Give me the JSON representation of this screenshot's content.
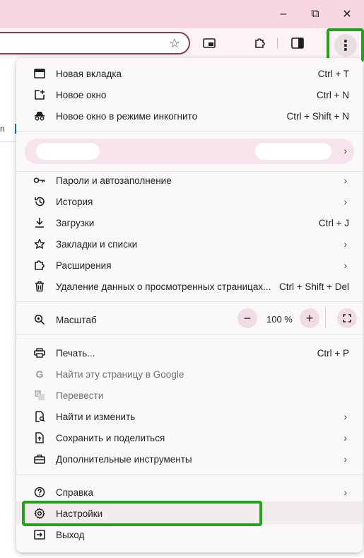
{
  "window": {
    "minimize_glyph": "–",
    "maximize_glyph": "⧉",
    "close_glyph": "✕"
  },
  "toolbar": {
    "star_glyph": "☆",
    "menu_glyph": "⋮"
  },
  "page": {
    "fragment": "n"
  },
  "menu": {
    "group1": [
      {
        "icon": "new-tab-icon",
        "label": "Новая вкладка",
        "shortcut": "Ctrl + T"
      },
      {
        "icon": "new-window-icon",
        "label": "Новое окно",
        "shortcut": "Ctrl + N"
      },
      {
        "icon": "incognito-icon",
        "label": "Новое окно в режиме инкогнито",
        "shortcut": "Ctrl + Shift + N"
      }
    ],
    "profile_chevron": "›",
    "group2": [
      {
        "icon": "key-icon",
        "label": "Пароли и автозаполнение",
        "chevron": "›"
      },
      {
        "icon": "history-icon",
        "label": "История",
        "chevron": "›"
      },
      {
        "icon": "download-icon",
        "label": "Загрузки",
        "shortcut": "Ctrl + J"
      },
      {
        "icon": "star-icon",
        "label": "Закладки и списки",
        "chevron": "›"
      },
      {
        "icon": "extension-icon",
        "label": "Расширения",
        "chevron": "›"
      },
      {
        "icon": "trash-icon",
        "label": "Удаление данных о просмотренных страницах...",
        "shortcut": "Ctrl + Shift + Del"
      }
    ],
    "zoom": {
      "label": "Масштаб",
      "minus": "−",
      "value": "100 %",
      "plus": "+"
    },
    "group3": [
      {
        "icon": "print-icon",
        "label": "Печать...",
        "shortcut": "Ctrl + P"
      },
      {
        "icon": "google-icon",
        "label": "Найти эту страницу в Google",
        "disabled": true
      },
      {
        "icon": "translate-icon",
        "label": "Перевести",
        "disabled": true
      },
      {
        "icon": "find-icon",
        "label": "Найти и изменить",
        "chevron": "›"
      },
      {
        "icon": "share-icon",
        "label": "Сохранить и поделиться",
        "chevron": "›"
      },
      {
        "icon": "tools-icon",
        "label": "Дополнительные инструменты",
        "chevron": "›"
      }
    ],
    "group4": [
      {
        "icon": "help-icon",
        "label": "Справка",
        "chevron": "›"
      },
      {
        "icon": "gear-icon",
        "label": "Настройки"
      },
      {
        "icon": "exit-icon",
        "label": "Выход"
      }
    ]
  },
  "colors": {
    "highlight": "#23a31b",
    "titlebar": "#f8d7e3",
    "menu_bg": "#fbf8fa"
  }
}
